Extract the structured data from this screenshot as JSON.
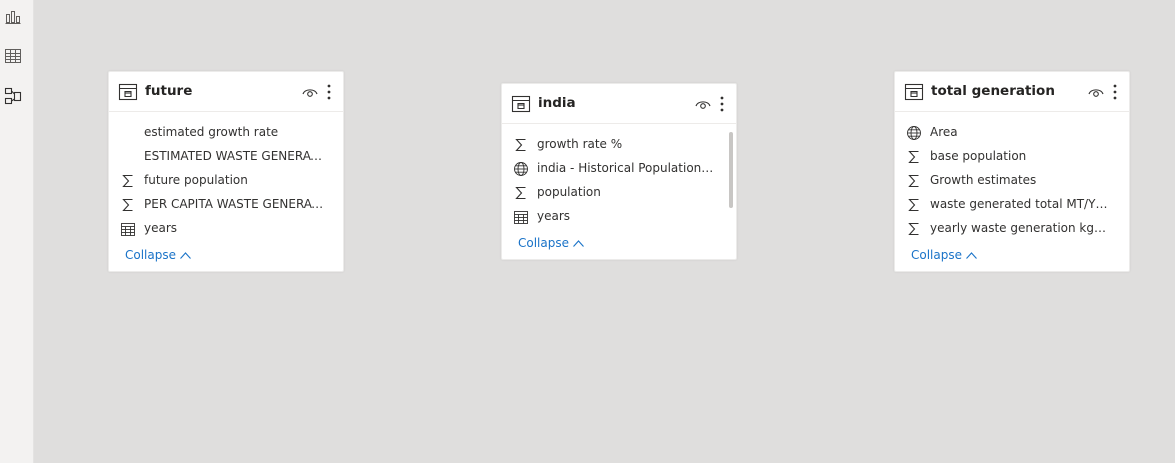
{
  "colors": {
    "canvas": "#dfdedd",
    "accent_link": "#1a73c8",
    "text": "#323130"
  },
  "rail": {
    "icons": [
      "report-view-icon",
      "data-view-icon",
      "model-view-icon"
    ]
  },
  "tables": [
    {
      "title": "future",
      "fields": [
        {
          "label": "estimated growth rate",
          "icon": "none"
        },
        {
          "label": "ESTIMATED WASTE GENERATIO...",
          "icon": "none"
        },
        {
          "label": "future population",
          "icon": "sigma-icon"
        },
        {
          "label": "PER CAPITA WASTE GENERATIO...",
          "icon": "sigma-icon"
        },
        {
          "label": "years",
          "icon": "calendar-icon"
        }
      ],
      "collapse_label": "Collapse"
    },
    {
      "title": "india",
      "fields": [
        {
          "label": "growth rate %",
          "icon": "sigma-icon"
        },
        {
          "label": "india - Historical Population Gr...",
          "icon": "globe-icon"
        },
        {
          "label": "population",
          "icon": "sigma-icon"
        },
        {
          "label": "years",
          "icon": "calendar-icon"
        }
      ],
      "collapse_label": "Collapse"
    },
    {
      "title": "total generation",
      "fields": [
        {
          "label": "Area",
          "icon": "globe-icon"
        },
        {
          "label": "base population",
          "icon": "sigma-icon"
        },
        {
          "label": "Growth estimates",
          "icon": "sigma-icon"
        },
        {
          "label": "waste generated total MT/YEAR",
          "icon": "sigma-icon"
        },
        {
          "label": "yearly waste generation kg/pers...",
          "icon": "sigma-icon"
        }
      ],
      "collapse_label": "Collapse"
    }
  ]
}
